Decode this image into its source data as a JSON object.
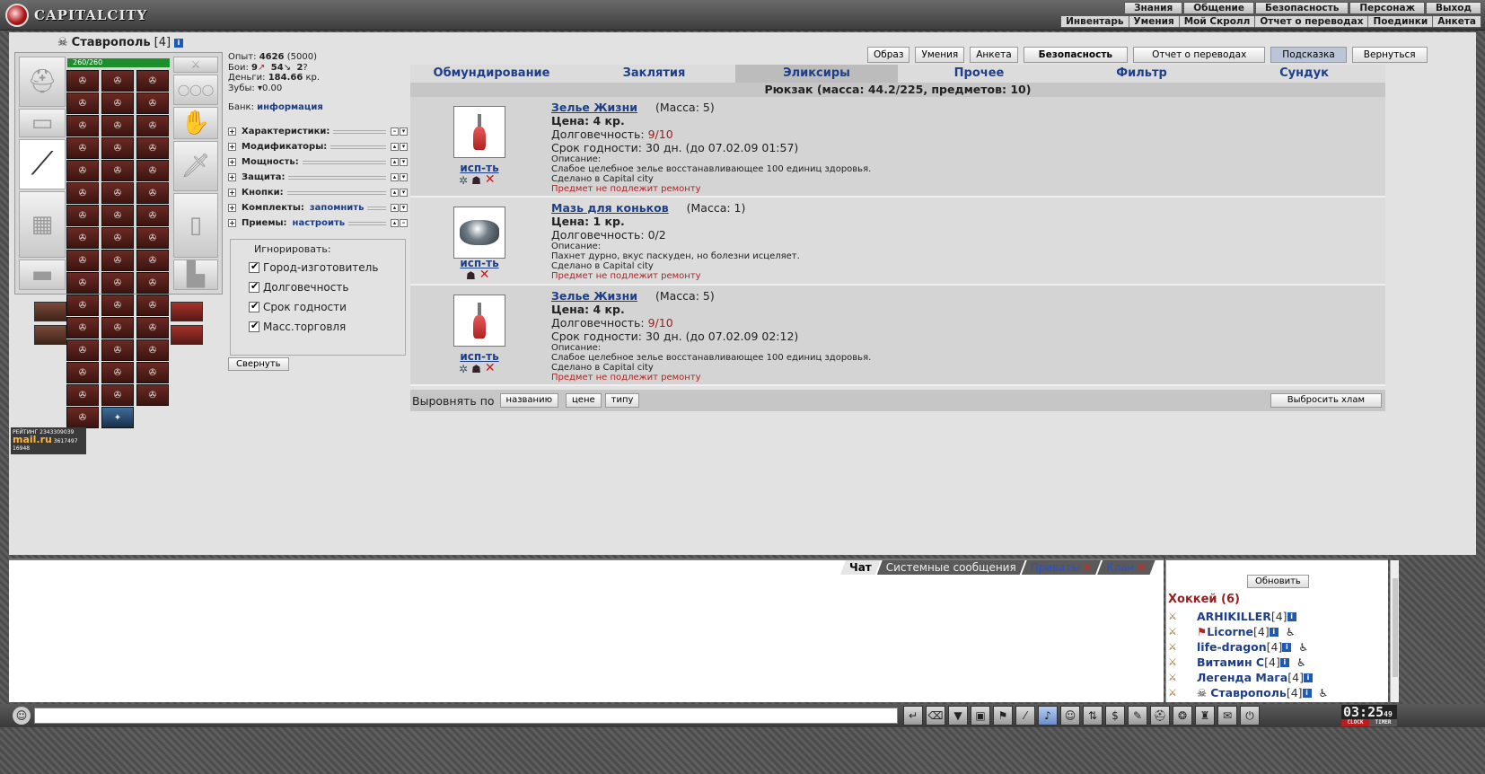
{
  "app": {
    "logo_text": "CAPITALCITY"
  },
  "top_menu": [
    "Знания",
    "Общение",
    "Безопасность",
    "Персонаж",
    "Выход"
  ],
  "sub_menu": [
    "Инвентарь",
    "Умения",
    "Мой Скролл",
    "Отчет о переводах",
    "Поединки",
    "Анкета"
  ],
  "character": {
    "name": "Ставрополь",
    "level": "[4]",
    "hp": "260/260",
    "stats": {
      "exp_label": "Опыт:",
      "exp_value": "4626",
      "exp_next": "(5000)",
      "battles_label": "Бои:",
      "wins": "9",
      "losses": "54",
      "draws": "2",
      "money_label": "Деньги:",
      "money_value": "184.66",
      "money_unit": "кр.",
      "teeth_label": "Зубы:",
      "teeth_value": "0.00"
    },
    "bank_label": "Банк:",
    "bank_link": "информация"
  },
  "accordion": [
    {
      "label": "Характеристики:",
      "link": ""
    },
    {
      "label": "Модификаторы:",
      "link": ""
    },
    {
      "label": "Мощность:",
      "link": ""
    },
    {
      "label": "Защита:",
      "link": ""
    },
    {
      "label": "Кнопки:",
      "link": ""
    },
    {
      "label": "Комплекты:",
      "link": "запомнить"
    },
    {
      "label": "Приемы:",
      "link": "настроить"
    }
  ],
  "ignore": {
    "legend": "Игнорировать:",
    "options": [
      "Город-изготовитель",
      "Долговечность",
      "Срок годности",
      "Масс.торговля"
    ]
  },
  "collapse_label": "Свернуть",
  "rating": {
    "label": "РЕЙТИНГ",
    "brand": "mail.ru",
    "n1": "2343309039",
    "n2": "3617497",
    "n3": "16948"
  },
  "top_buttons": [
    "Образ",
    "Умения",
    "Анкета",
    "Безопасность",
    "Отчет о переводах",
    "Подсказка",
    "Вернуться"
  ],
  "tabs": [
    "Обмундирование",
    "Заклятия",
    "Эликсиры",
    "Прочее",
    "Фильтр",
    "Сундук"
  ],
  "active_tab": "Эликсиры",
  "pack_title": "Рюкзак (масса: 44.2/225, предметов: 10)",
  "items": [
    {
      "name": "Зелье Жизни",
      "mass": "(Масса: 5)",
      "price": "Цена: 4 кр.",
      "dur_label": "Долговечность:",
      "dur_value": "9/10",
      "expiry": "Срок годности: 30 дн. (до 07.02.09 01:57)",
      "desc_label": "Описание:",
      "desc": "Слабое целебное зелье восстанавливающее 100 единиц здоровья.",
      "made": "Сделано в Capital city",
      "no_repair": "Предмет не подлежит ремонту",
      "use": "исп-ть"
    },
    {
      "name": "Мазь для коньков",
      "mass": "(Масса: 1)",
      "price": "Цена: 1 кр.",
      "dur_label": "Долговечность:",
      "dur_value": "0/2",
      "desc_label": "Описание:",
      "desc": "Пахнет дурно, вкус паскуден, но болезни исцеляет.",
      "made": "Сделано в Capital city",
      "no_repair": "Предмет не подлежит ремонту",
      "use": "исп-ть"
    },
    {
      "name": "Зелье Жизни",
      "mass": "(Масса: 5)",
      "price": "Цена: 4 кр.",
      "dur_label": "Долговечность:",
      "dur_value": "9/10",
      "expiry": "Срок годности: 30 дн. (до 07.02.09 02:12)",
      "desc_label": "Описание:",
      "desc": "Слабое целебное зелье восстанавливающее 100 единиц здоровья.",
      "made": "Сделано в Capital city",
      "no_repair": "Предмет не подлежит ремонту",
      "use": "исп-ть"
    }
  ],
  "sort": {
    "label": "Выровнять по",
    "options": [
      "названию",
      "цене",
      "типу"
    ],
    "junk": "Выбросить хлам"
  },
  "chat_tabs": [
    "Чат",
    "Системные сообщения",
    "Приваты",
    "Клан"
  ],
  "online": {
    "refresh": "Обновить",
    "room": "Хоккей (6)",
    "users": [
      {
        "name": "ARHIKILLER",
        "level": "[4]"
      },
      {
        "name": "Licorne",
        "level": "[4]"
      },
      {
        "name": "life-dragon",
        "level": "[4]"
      },
      {
        "name": "Витамин С",
        "level": "[4]"
      },
      {
        "name": "Легенда Мага",
        "level": "[4]"
      },
      {
        "name": "Ставрополь",
        "level": "[4]"
      }
    ]
  },
  "clock": {
    "time": "03:25",
    "seconds": "49",
    "clock_label": "CLOCK",
    "timer_label": "TIMER"
  },
  "colors": {
    "accent_link": "#1e3f88",
    "warning_red": "#b02323",
    "hp_green": "#1e8e2c"
  }
}
